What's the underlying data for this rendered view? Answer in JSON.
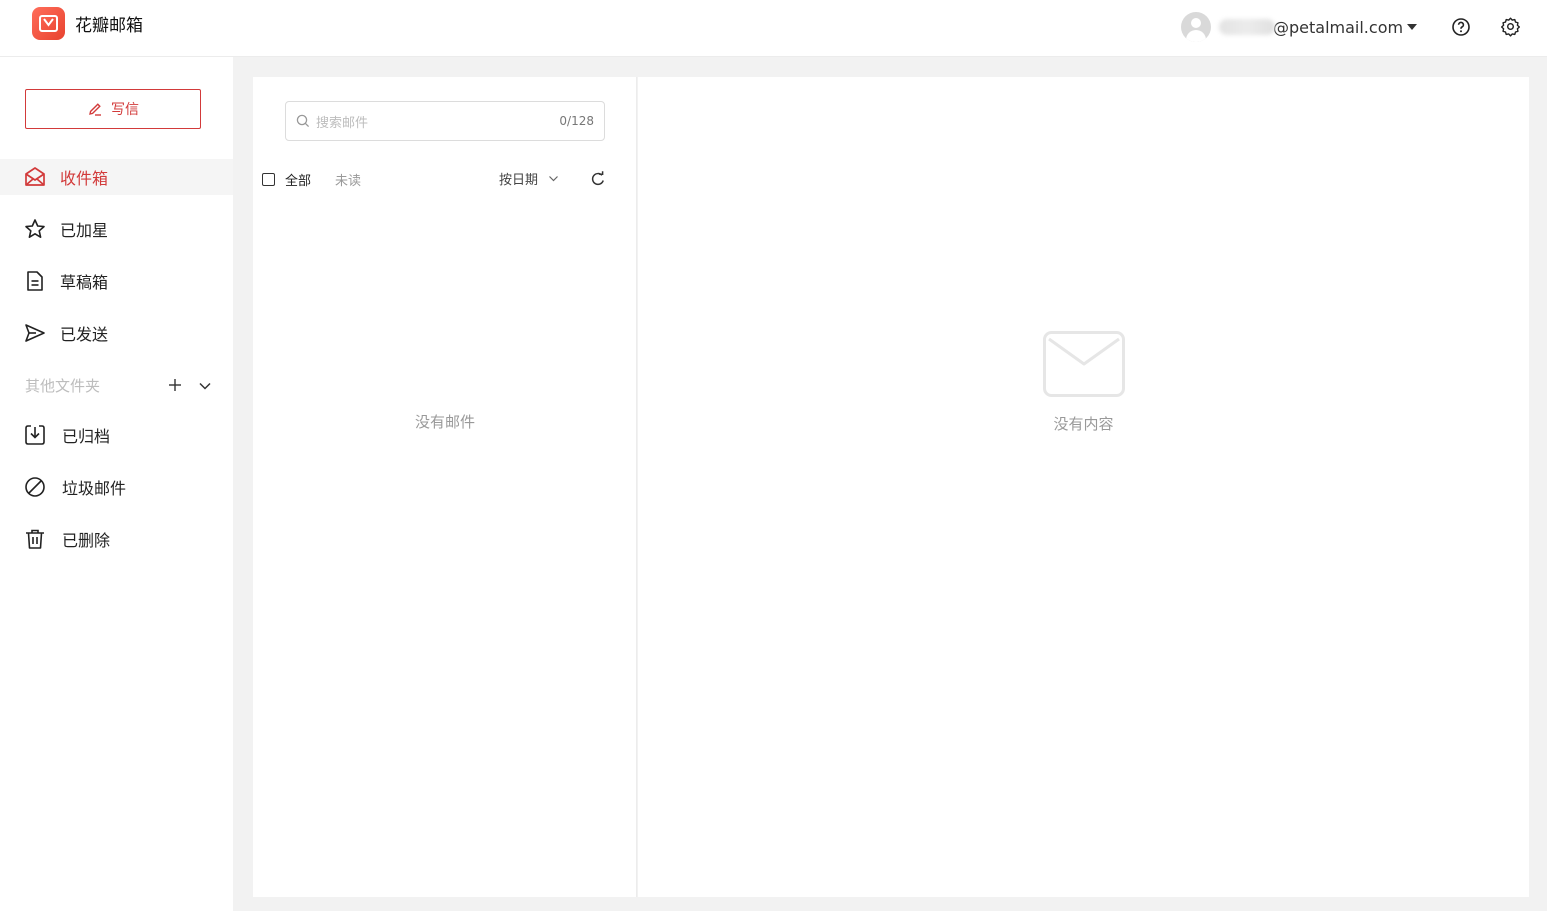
{
  "app": {
    "title": "花瓣邮箱"
  },
  "account": {
    "email": "@petalmail.com"
  },
  "compose": {
    "label": "写信"
  },
  "sidebar": {
    "items": [
      {
        "label": "收件箱",
        "icon": "inbox-icon",
        "active": true
      },
      {
        "label": "已加星",
        "icon": "star-icon"
      },
      {
        "label": "草稿箱",
        "icon": "draft-icon"
      },
      {
        "label": "已发送",
        "icon": "send-icon"
      }
    ],
    "other_folders_label": "其他文件夹",
    "folders": [
      {
        "label": "已归档",
        "icon": "archive-icon"
      },
      {
        "label": "垃圾邮件",
        "icon": "spam-icon"
      },
      {
        "label": "已删除",
        "icon": "trash-icon"
      }
    ]
  },
  "search": {
    "placeholder": "搜索邮件",
    "count": "0/128"
  },
  "filters": {
    "all": "全部",
    "unread": "未读",
    "sort": "按日期"
  },
  "list": {
    "empty_text": "没有邮件"
  },
  "reader": {
    "empty_text": "没有内容"
  },
  "colors": {
    "accent": "#d23a3a",
    "logo": "#e8432f"
  }
}
